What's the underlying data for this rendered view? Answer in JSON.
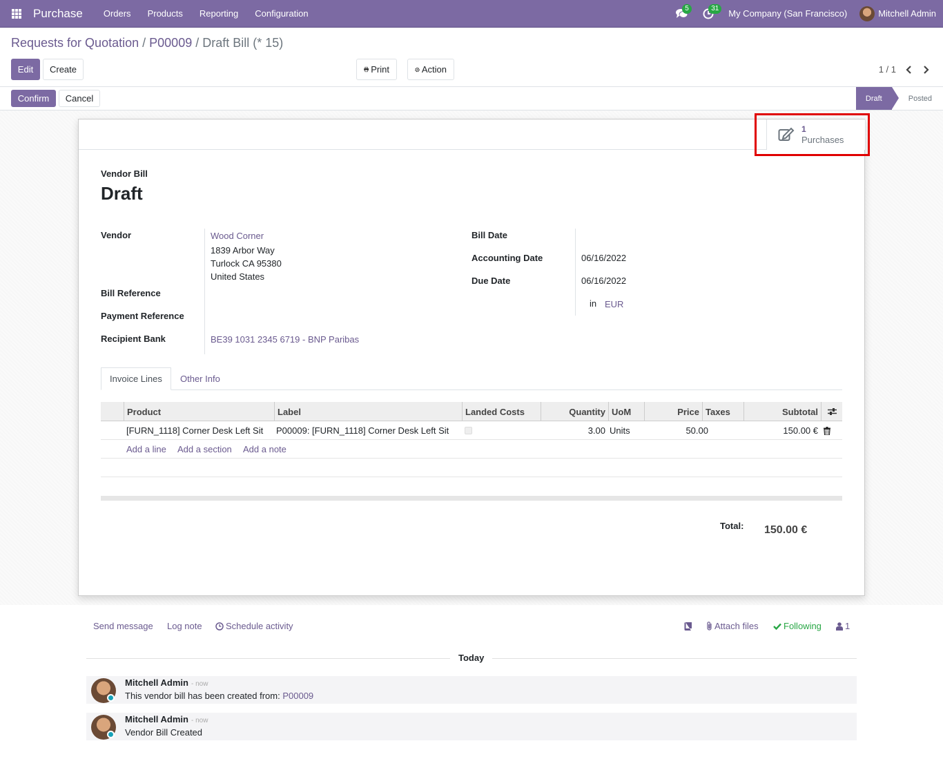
{
  "navbar": {
    "app_name": "Purchase",
    "menu": [
      "Orders",
      "Products",
      "Reporting",
      "Configuration"
    ],
    "messages_count": "5",
    "activities_count": "31",
    "company": "My Company (San Francisco)",
    "user": "Mitchell Admin"
  },
  "breadcrumb": {
    "root": "Requests for Quotation",
    "parent": "P00009",
    "current": "Draft Bill (* 15)",
    "separator": "/"
  },
  "toolbar": {
    "edit": "Edit",
    "create": "Create",
    "print": "Print",
    "action": "Action",
    "pager": "1 / 1"
  },
  "status": {
    "confirm": "Confirm",
    "cancel": "Cancel",
    "steps": [
      "Draft",
      "Posted"
    ],
    "active_step": "Draft"
  },
  "smart_button": {
    "count": "1",
    "label": "Purchases"
  },
  "form": {
    "doc_type": "Vendor Bill",
    "title": "Draft",
    "labels": {
      "vendor": "Vendor",
      "bill_reference": "Bill Reference",
      "payment_reference": "Payment Reference",
      "recipient_bank": "Recipient Bank",
      "bill_date": "Bill Date",
      "accounting_date": "Accounting Date",
      "due_date": "Due Date",
      "currency_in": "in"
    },
    "vendor_name": "Wood Corner",
    "vendor_address": [
      "1839 Arbor Way",
      "Turlock CA 95380",
      "United States"
    ],
    "recipient_bank": "BE39 1031 2345 6719 - BNP Paribas",
    "bill_date": "",
    "accounting_date": "06/16/2022",
    "due_date": "06/16/2022",
    "currency": "EUR"
  },
  "tabs": [
    "Invoice Lines",
    "Other Info"
  ],
  "lines": {
    "columns": [
      "Product",
      "Label",
      "Landed Costs",
      "Quantity",
      "UoM",
      "Price",
      "Taxes",
      "Subtotal"
    ],
    "rows": [
      {
        "product": "[FURN_1118] Corner Desk Left Sit",
        "label": "P00009: [FURN_1118] Corner Desk Left Sit",
        "quantity": "3.00",
        "uom": "Units",
        "price": "50.00",
        "taxes": "",
        "subtotal": "150.00 €"
      }
    ],
    "add_line": "Add a line",
    "add_section": "Add a section",
    "add_note": "Add a note"
  },
  "totals": {
    "label": "Total:",
    "value": "150.00 €"
  },
  "chatter": {
    "send_message": "Send message",
    "log_note": "Log note",
    "schedule_activity": "Schedule activity",
    "attach_files": "Attach files",
    "following": "Following",
    "followers": "1",
    "day_separator": "Today",
    "messages": [
      {
        "author": "Mitchell Admin",
        "time": "- now",
        "text": "This vendor bill has been created from: ",
        "link": "P00009"
      },
      {
        "author": "Mitchell Admin",
        "time": "- now",
        "text": "Vendor Bill Created",
        "link": ""
      }
    ]
  },
  "colors": {
    "brand": "#7c6aa3",
    "link": "#6a5a8f",
    "badge": "#28a745",
    "highlight": "#e00000"
  }
}
